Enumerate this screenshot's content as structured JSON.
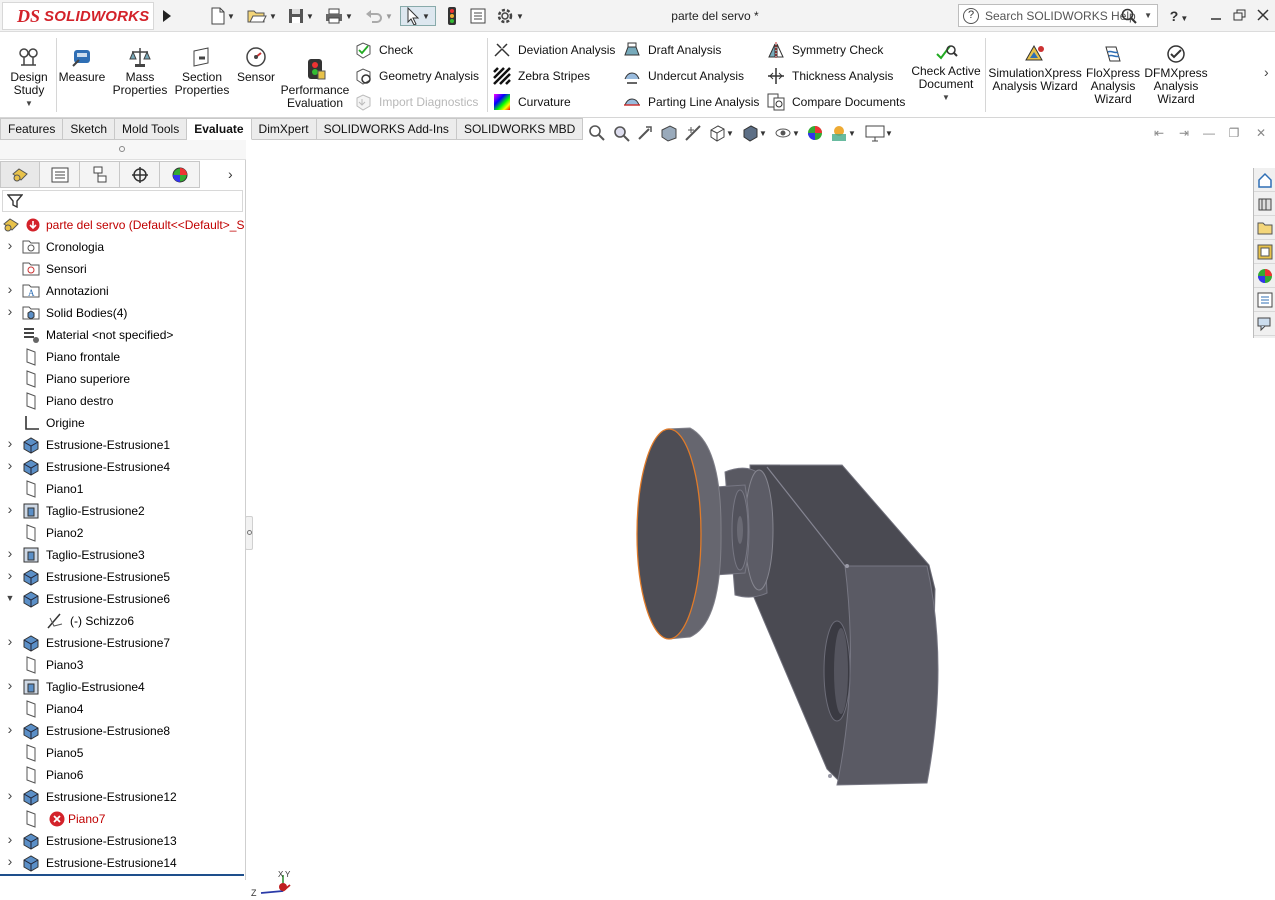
{
  "titlebar": {
    "brand_prefix": "DS",
    "brand": "SOLIDWORKS",
    "document_title": "parte del servo *",
    "search_placeholder": "Search SOLIDWORKS Help",
    "help_symbol": "?",
    "icons": [
      "arrow-right-icon",
      "new-doc-icon",
      "open-icon",
      "save-icon",
      "print-icon",
      "undo-icon",
      "select-cursor-icon",
      "traffic-light-icon",
      "file-properties-icon",
      "options-gear-icon"
    ]
  },
  "command_manager": {
    "big_buttons": [
      {
        "label": "Design\nStudy",
        "icon": "design-study-icon"
      },
      {
        "label": "Measure",
        "icon": "measure-icon"
      },
      {
        "label": "Mass\nProperties",
        "icon": "mass-properties-icon"
      },
      {
        "label": "Section\nProperties",
        "icon": "section-properties-icon"
      },
      {
        "label": "Sensor",
        "icon": "sensor-icon"
      },
      {
        "label": "Performance\nEvaluation",
        "icon": "performance-evaluation-icon"
      }
    ],
    "col1": [
      {
        "label": "Check",
        "icon": "check-icon",
        "enabled": true
      },
      {
        "label": "Geometry Analysis",
        "icon": "geometry-analysis-icon",
        "enabled": true
      },
      {
        "label": "Import Diagnostics",
        "icon": "import-diagnostics-icon",
        "enabled": false
      }
    ],
    "col2": [
      {
        "label": "Deviation Analysis",
        "icon": "deviation-analysis-icon"
      },
      {
        "label": "Zebra Stripes",
        "icon": "zebra-stripes-icon"
      },
      {
        "label": "Curvature",
        "icon": "curvature-icon"
      }
    ],
    "col3": [
      {
        "label": "Draft Analysis",
        "icon": "draft-analysis-icon"
      },
      {
        "label": "Undercut Analysis",
        "icon": "undercut-analysis-icon"
      },
      {
        "label": "Parting Line Analysis",
        "icon": "parting-line-analysis-icon"
      }
    ],
    "col4": [
      {
        "label": "Symmetry Check",
        "icon": "symmetry-check-icon"
      },
      {
        "label": "Thickness Analysis",
        "icon": "thickness-analysis-icon"
      },
      {
        "label": "Compare Documents",
        "icon": "compare-documents-icon"
      }
    ],
    "check_active": {
      "label": "Check Active\nDocument",
      "icon": "check-active-document-icon"
    },
    "xpress": [
      {
        "label": "SimulationXpress\nAnalysis Wizard",
        "icon": "simulationxpress-icon"
      },
      {
        "label": "FloXpress\nAnalysis\nWizard",
        "icon": "floxpress-icon"
      },
      {
        "label": "DFMXpress\nAnalysis\nWizard",
        "icon": "dfmxpress-icon"
      }
    ]
  },
  "tabs": [
    {
      "label": "Features",
      "active": false
    },
    {
      "label": "Sketch",
      "active": false
    },
    {
      "label": "Mold Tools",
      "active": false
    },
    {
      "label": "Evaluate",
      "active": true
    },
    {
      "label": "DimXpert",
      "active": false
    },
    {
      "label": "SOLIDWORKS Add-Ins",
      "active": false
    },
    {
      "label": "SOLIDWORKS MBD",
      "active": false
    }
  ],
  "feature_tree": {
    "root": "parte del servo  (Default<<Default>_S",
    "items": [
      {
        "label": "Cronologia",
        "icon": "history-icon",
        "expandable": true,
        "level": 0
      },
      {
        "label": "Sensori",
        "icon": "sensor-folder-icon",
        "expandable": false,
        "level": 0
      },
      {
        "label": "Annotazioni",
        "icon": "annotations-icon",
        "expandable": true,
        "level": 0
      },
      {
        "label": "Solid Bodies(4)",
        "icon": "solid-bodies-icon",
        "expandable": true,
        "level": 0
      },
      {
        "label": "Material <not specified>",
        "icon": "material-icon",
        "expandable": false,
        "level": 0
      },
      {
        "label": "Piano frontale",
        "icon": "plane-icon",
        "expandable": false,
        "level": 0
      },
      {
        "label": "Piano superiore",
        "icon": "plane-icon",
        "expandable": false,
        "level": 0
      },
      {
        "label": "Piano destro",
        "icon": "plane-icon",
        "expandable": false,
        "level": 0
      },
      {
        "label": "Origine",
        "icon": "origin-icon",
        "expandable": false,
        "level": 0
      },
      {
        "label": "Estrusione-Estrusione1",
        "icon": "extrude-icon",
        "expandable": true,
        "level": 0
      },
      {
        "label": "Estrusione-Estrusione4",
        "icon": "extrude-icon",
        "expandable": true,
        "level": 0
      },
      {
        "label": "Piano1",
        "icon": "plane-icon",
        "expandable": false,
        "level": 0
      },
      {
        "label": "Taglio-Estrusione2",
        "icon": "cut-extrude-icon",
        "expandable": true,
        "level": 0
      },
      {
        "label": "Piano2",
        "icon": "plane-icon",
        "expandable": false,
        "level": 0
      },
      {
        "label": "Taglio-Estrusione3",
        "icon": "cut-extrude-icon",
        "expandable": true,
        "level": 0
      },
      {
        "label": "Estrusione-Estrusione5",
        "icon": "extrude-icon",
        "expandable": true,
        "level": 0
      },
      {
        "label": "Estrusione-Estrusione6",
        "icon": "extrude-icon",
        "expandable": true,
        "expanded": true,
        "level": 0
      },
      {
        "label": "(-) Schizzo6",
        "icon": "sketch-icon",
        "expandable": false,
        "level": 1
      },
      {
        "label": "Estrusione-Estrusione7",
        "icon": "extrude-icon",
        "expandable": true,
        "level": 0
      },
      {
        "label": "Piano3",
        "icon": "plane-icon",
        "expandable": false,
        "level": 0
      },
      {
        "label": "Taglio-Estrusione4",
        "icon": "cut-extrude-icon",
        "expandable": true,
        "level": 0
      },
      {
        "label": "Piano4",
        "icon": "plane-icon",
        "expandable": false,
        "level": 0
      },
      {
        "label": "Estrusione-Estrusione8",
        "icon": "extrude-icon",
        "expandable": true,
        "level": 0
      },
      {
        "label": "Piano5",
        "icon": "plane-icon",
        "expandable": false,
        "level": 0
      },
      {
        "label": "Piano6",
        "icon": "plane-icon",
        "expandable": false,
        "level": 0
      },
      {
        "label": "Estrusione-Estrusione12",
        "icon": "extrude-icon",
        "expandable": true,
        "level": 0
      },
      {
        "label": "Piano7",
        "icon": "plane-icon",
        "expandable": false,
        "level": 0,
        "error": true
      },
      {
        "label": "Estrusione-Estrusione13",
        "icon": "extrude-icon",
        "expandable": true,
        "level": 0
      },
      {
        "label": "Estrusione-Estrusione14",
        "icon": "extrude-icon",
        "expandable": true,
        "level": 0
      }
    ]
  },
  "triad": {
    "x": "X",
    "y": "Y",
    "z": "Z"
  },
  "colors": {
    "brand_red": "#d3222a",
    "model_face": "#4b4b52",
    "model_edge": "#7a7a86",
    "selected_edge": "#e07b2a",
    "tree_error": "#c00000"
  }
}
